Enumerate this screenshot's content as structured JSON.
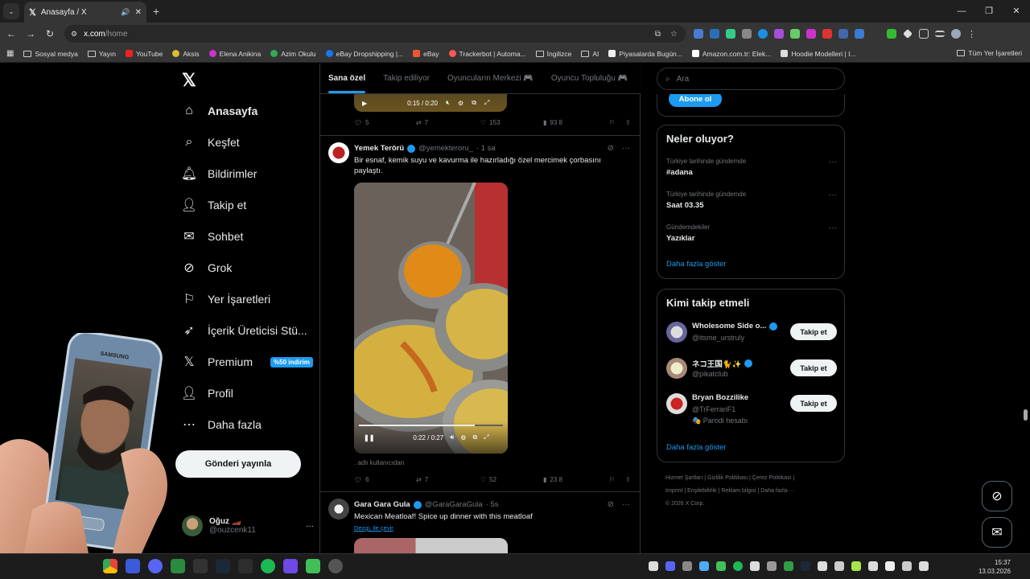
{
  "browser": {
    "tab_title": "Anasayfa / X",
    "url_domain": "x.com",
    "url_path": "/home",
    "bookmarks": [
      "Sosyal medya",
      "Yayın",
      "YouTube",
      "Aksis",
      "Elena Anikina",
      "Azim Okulu",
      "eBay Dropshipping |...",
      "eBay",
      "Trackerbot | Automa...",
      "İngilizce",
      "AI",
      "Piyasalarda Bugün...",
      "Amazon.com.tr: Elek...",
      "Hoodie Modelleri | I..."
    ],
    "bookmarks_all": "Tüm Yer İşaretleri"
  },
  "nav": {
    "items": [
      "Anasayfa",
      "Keşfet",
      "Bildirimler",
      "Takip et",
      "Sohbet",
      "Grok",
      "Yer İşaretleri",
      "İçerik Üreticisi Stü...",
      "Premium",
      "Profil",
      "Daha fazla"
    ],
    "premium_badge": "%50 indirim",
    "post_button": "Gönderi yayınla",
    "user_name": "Oğuz 🏎️",
    "user_handle": "@ouzcenk11"
  },
  "feed": {
    "tabs": [
      "Sana özel",
      "Takip ediliyor",
      "Oyuncuların Merkezi 🎮",
      "Oyuncu Topluluğu 🎮"
    ],
    "prev_post": {
      "time": "0:15 / 0:20",
      "replies": "5",
      "reposts": "7",
      "likes": "153",
      "views": "93 8"
    },
    "post1": {
      "name": "Yemek Terörü",
      "handle": "@yemekteroru_",
      "time": "· 1 sa",
      "text": "Bir esnaf, kemik suyu ve kavurma ile hazırladığı özel mercimek çorbasını paylaştı.",
      "video_time": "0:22 / 0:27",
      "attribution": ". adlı kullanıcıdan",
      "replies": "6",
      "reposts": "7",
      "likes": "52",
      "views": "23 8"
    },
    "post2": {
      "name": "Gara Gara Gula",
      "handle": "@GaraGaraGula",
      "time": "· 5s",
      "text": "Mexican Meatloaf! Spice up dinner with this meatloaf",
      "translate": "Dezgi, ile çevir"
    }
  },
  "right": {
    "search_placeholder": "Ara",
    "subscribe": "Abone ol",
    "trends_title": "Neler oluyor?",
    "trends": [
      {
        "context": "Türkiye tarihinde gündemde",
        "title": "#adana"
      },
      {
        "context": "Türkiye tarihinde gündemde",
        "title": "Saat 03.35"
      },
      {
        "context": "Gündemdekiler",
        "title": "Yazıklar"
      }
    ],
    "show_more": "Daha fazla göster",
    "who_title": "Kimi takip etmeli",
    "who": [
      {
        "name": "Wholesome Side o...",
        "handle": "@itsme_urstruly",
        "extra": ""
      },
      {
        "name": "ネコ王国🐈✨",
        "handle": "@pikatclub",
        "extra": ""
      },
      {
        "name": "Bryan Bozzilike",
        "handle": "@TrFerrariF1",
        "extra": "🎭 Parodi hesabı"
      }
    ],
    "follow_label": "Takip et",
    "footer_line1": "Hizmet Şartları | Gizlilik Politikası | Çerez Politikası |",
    "footer_line2": "Imprint | Erişilebilirlik | Reklam bilgisi | Daha fazla ···",
    "footer_line3": "© 2026 X Corp."
  },
  "taskbar": {
    "time": "15:37",
    "date": "13.03.2026"
  }
}
